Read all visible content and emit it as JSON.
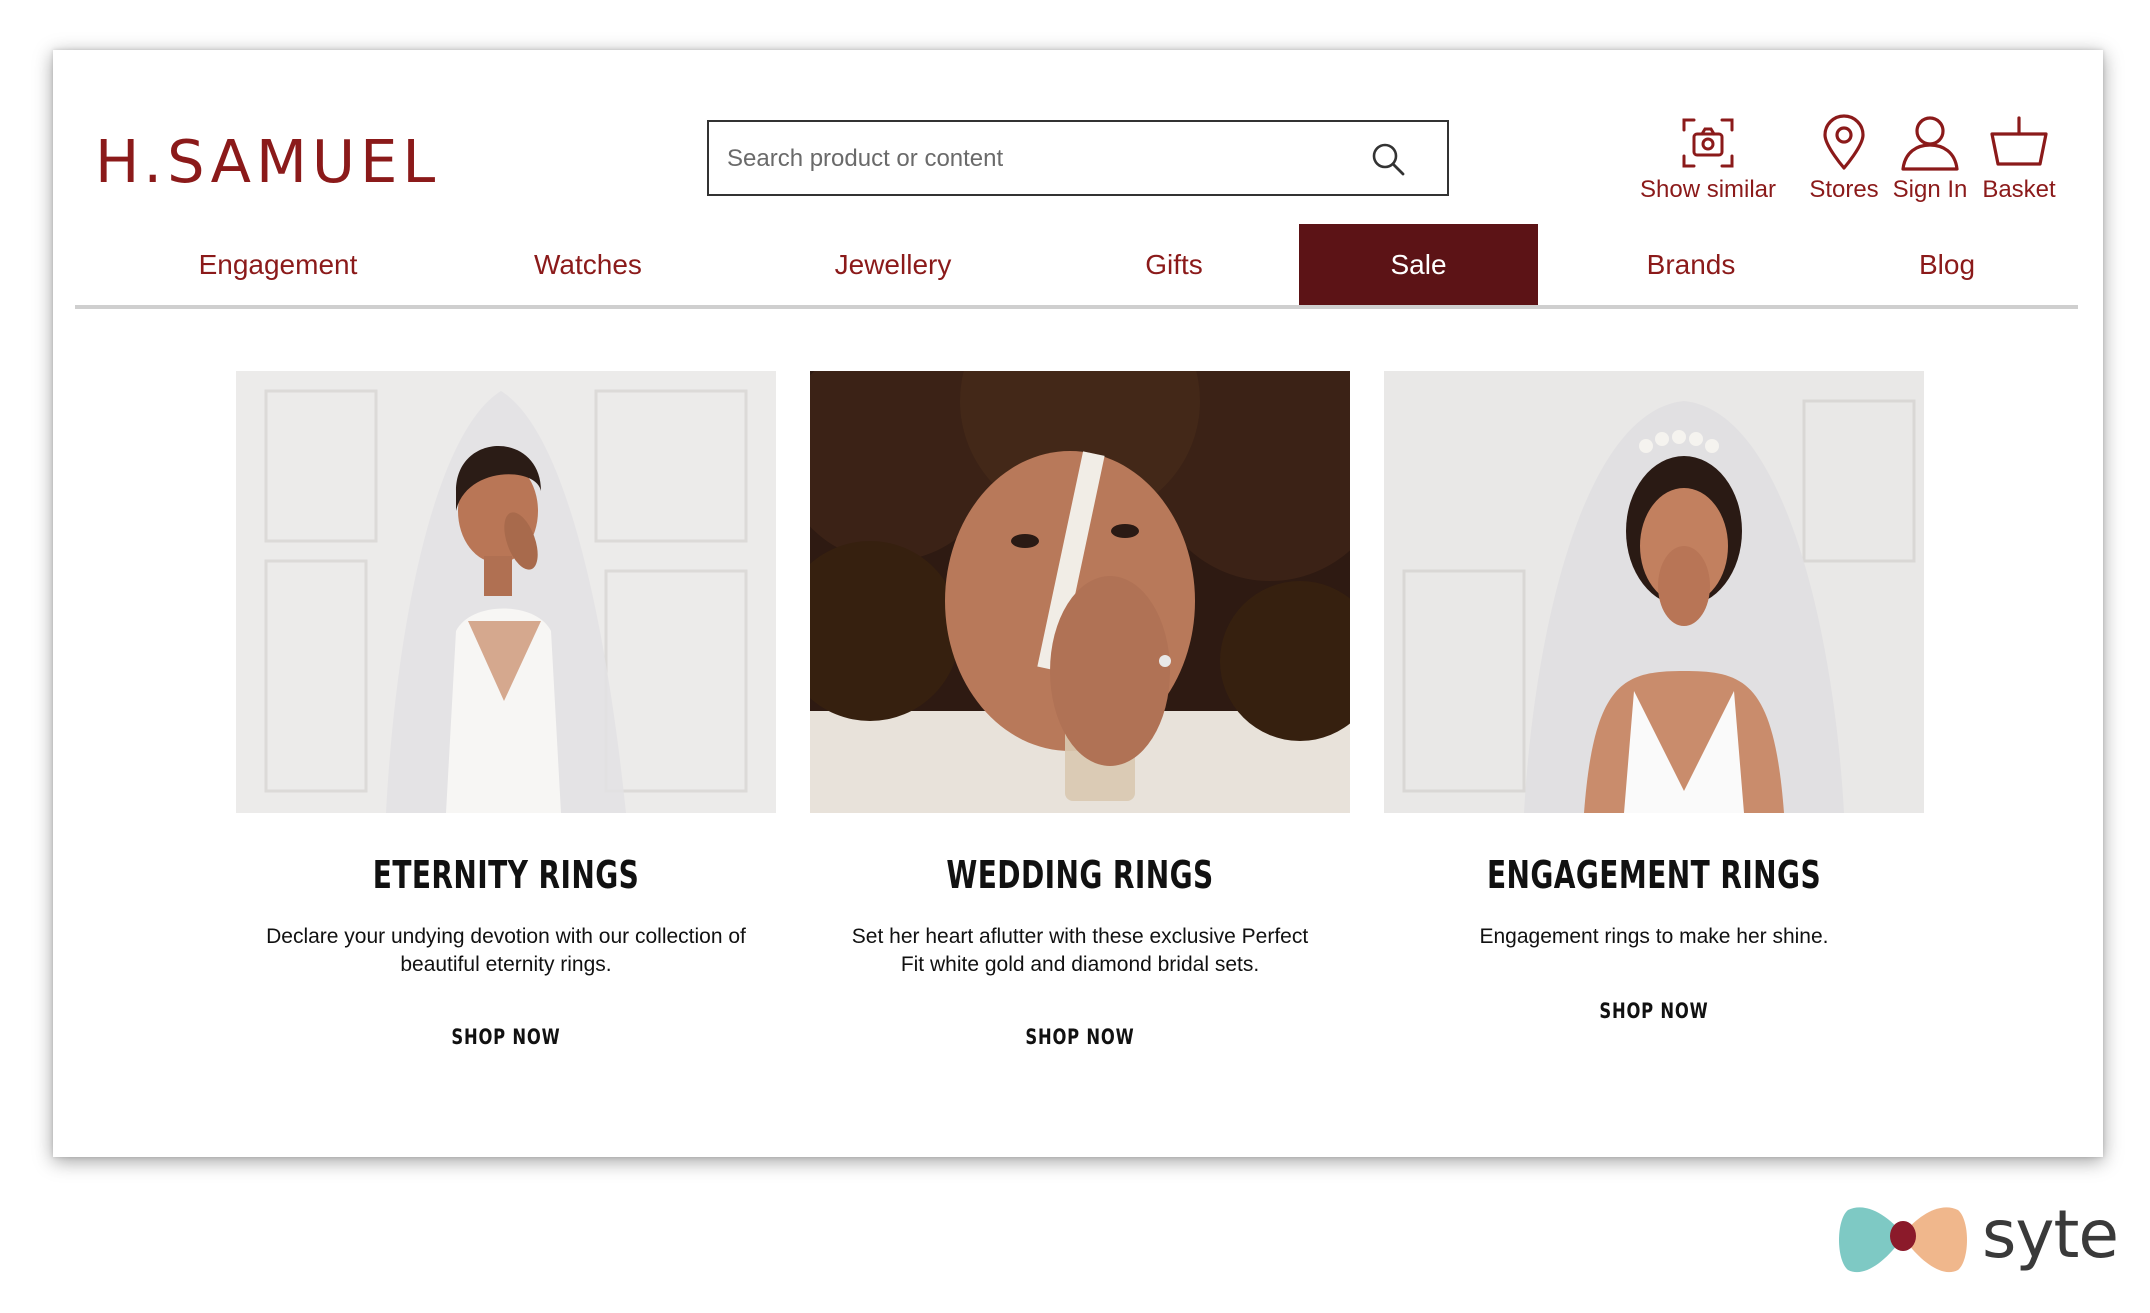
{
  "brand": {
    "logo_text": "H.SAMUEL",
    "color": "#8b1a1a"
  },
  "search": {
    "placeholder": "Search product or content",
    "icon": "search-icon"
  },
  "header_actions": [
    {
      "label": "Show similar",
      "icon": "camera-scan-icon"
    },
    {
      "label": "Stores",
      "icon": "map-pin-icon"
    },
    {
      "label": "Sign In",
      "icon": "user-icon"
    },
    {
      "label": "Basket",
      "icon": "basket-icon"
    }
  ],
  "nav": {
    "items": [
      "Engagement",
      "Watches",
      "Jewellery",
      "Gifts",
      "Sale",
      "Brands",
      "Blog"
    ],
    "active": "Sale",
    "active_bg": "#5c1316"
  },
  "cards": [
    {
      "title": "ETERNITY RINGS",
      "description": "Declare your undying devotion with our collection of beautiful eternity rings.",
      "cta": "SHOP NOW",
      "image": "bride-with-veil-photo"
    },
    {
      "title": "WEDDING RINGS",
      "description": "Set her heart aflutter with these exclusive Perfect Fit white gold and diamond bridal sets.",
      "cta": "SHOP NOW",
      "image": "curly-haired-woman-with-glass-photo"
    },
    {
      "title": "ENGAGEMENT RINGS",
      "description": "Engagement rings to make her shine.",
      "cta": "SHOP NOW",
      "image": "smiling-bride-with-pearl-headband-photo"
    }
  ],
  "watermark": {
    "text": "syte"
  }
}
